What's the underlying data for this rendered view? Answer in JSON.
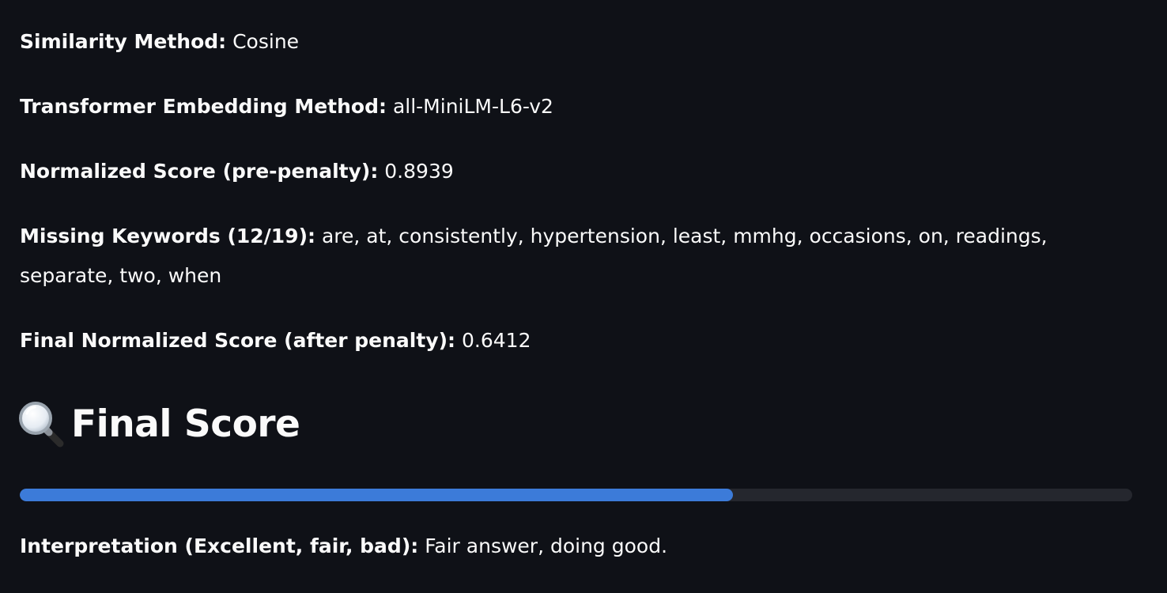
{
  "results": {
    "similarity_method": {
      "label": "Similarity Method:",
      "value": "Cosine"
    },
    "embedding_method": {
      "label": "Transformer Embedding Method:",
      "value": "all-MiniLM-L6-v2"
    },
    "normalized_score": {
      "label": "Normalized Score (pre-penalty):",
      "value": "0.8939"
    },
    "missing_keywords": {
      "label": "Missing Keywords (12/19):",
      "value": "are, at, consistently, hypertension, least, mmhg, occasions, on, readings, separate, two, when"
    },
    "final_normalized_score": {
      "label": "Final Normalized Score (after penalty):",
      "value": "0.6412"
    }
  },
  "final_score": {
    "icon": "magnifying-glass-icon",
    "title": "Final Score",
    "progress": 0.6412,
    "progress_color": "#3c7bd9",
    "track_color": "#25272e"
  },
  "interpretation": {
    "label": "Interpretation (Excellent, fair, bad):",
    "value": "Fair answer, doing good."
  },
  "colors": {
    "background": "#0f1117",
    "text": "#fafafa"
  }
}
